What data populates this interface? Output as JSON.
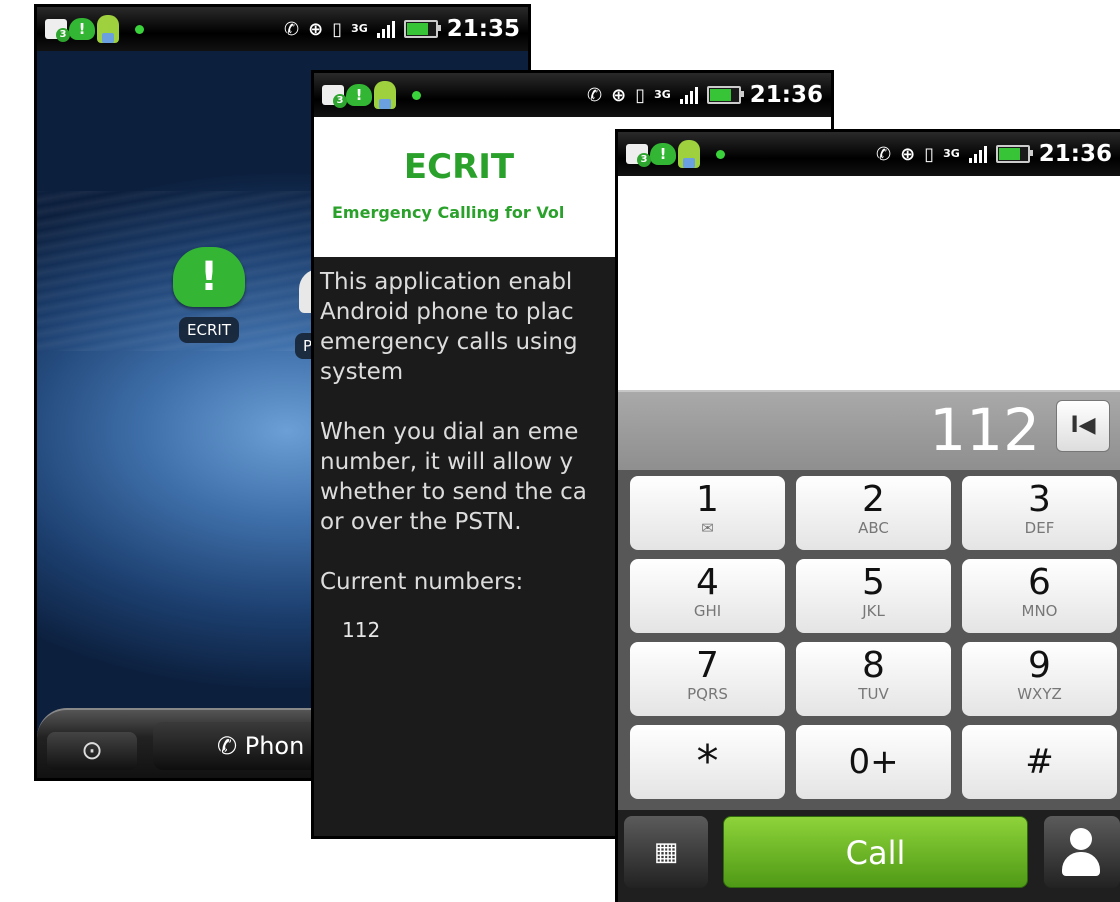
{
  "status_time_1": "21:35",
  "status_time_2": "21:36",
  "status_time_3": "21:36",
  "status_network": "3G",
  "home": {
    "app_label": "ECRIT",
    "second_app_label": "P",
    "dock_phone": "Phon"
  },
  "ecrit": {
    "title": "ECRIT",
    "subtitle": "Emergency Calling for Vol",
    "paragraphs": [
      "This application enabl\nAndroid phone to plac\nemergency calls using\nsystem",
      "When you dial an eme\nnumber, it will allow y\nwhether to send the ca\nor over the PSTN.",
      "Current numbers:"
    ],
    "numbers": [
      "112"
    ]
  },
  "dialer": {
    "number": "112",
    "keys": [
      {
        "digit": "1",
        "letters": ""
      },
      {
        "digit": "2",
        "letters": "ABC"
      },
      {
        "digit": "3",
        "letters": "DEF"
      },
      {
        "digit": "4",
        "letters": "GHI"
      },
      {
        "digit": "5",
        "letters": "JKL"
      },
      {
        "digit": "6",
        "letters": "MNO"
      },
      {
        "digit": "7",
        "letters": "PQRS"
      },
      {
        "digit": "8",
        "letters": "TUV"
      },
      {
        "digit": "9",
        "letters": "WXYZ"
      },
      {
        "digit": "*",
        "letters": ""
      },
      {
        "digit": "0+",
        "letters": ""
      },
      {
        "digit": "#",
        "letters": ""
      }
    ],
    "call_label": "Call"
  }
}
